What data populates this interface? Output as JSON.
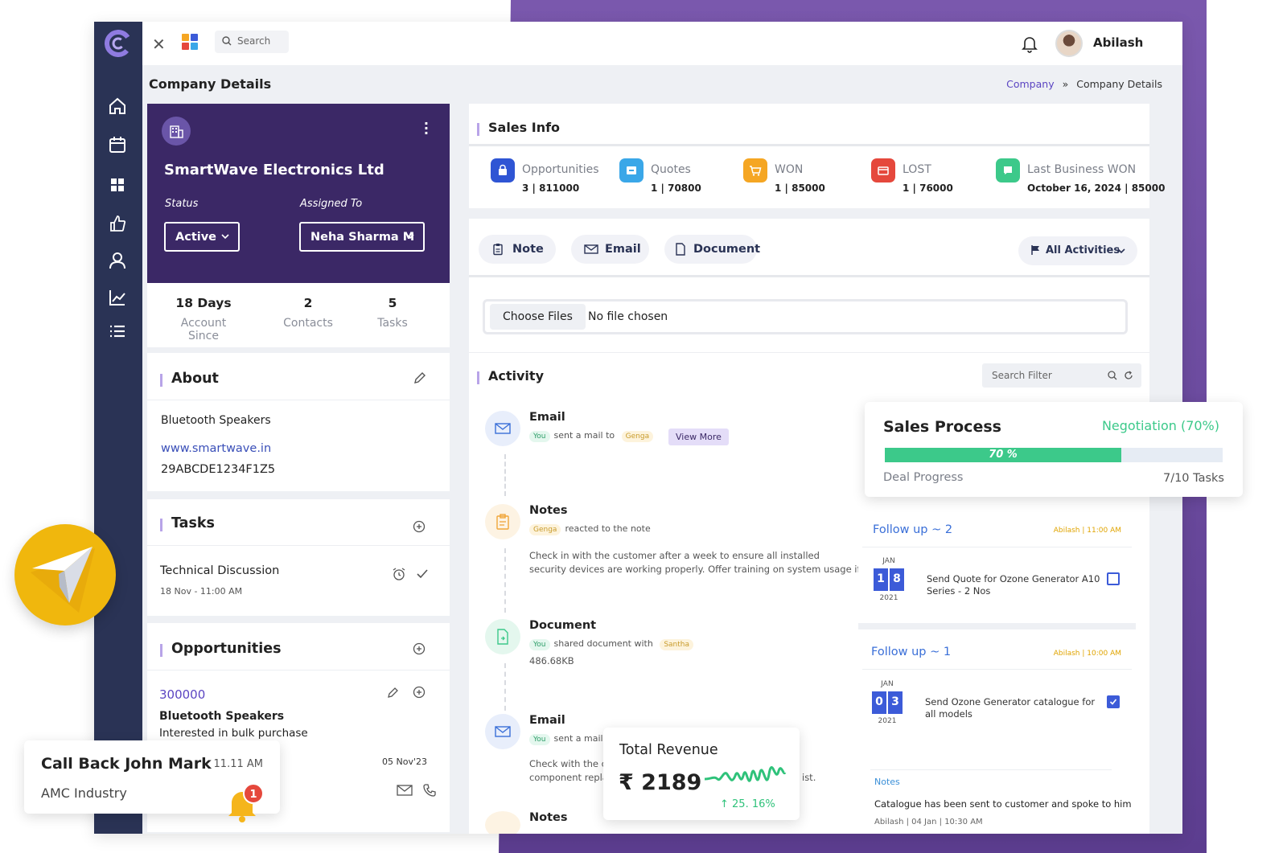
{
  "topbar": {
    "search_placeholder": "Search",
    "user_name": "Abilash"
  },
  "page": {
    "title": "Company Details",
    "breadcrumb": [
      "Company",
      "»",
      "Company Details"
    ]
  },
  "company": {
    "name": "SmartWave Electronics Ltd",
    "status_label": "Status",
    "status_value": "Active",
    "assigned_label": "Assigned To",
    "assigned_value": "Neha Sharma M"
  },
  "stats": [
    {
      "value": "18 Days",
      "label": "Account Since"
    },
    {
      "value": "2",
      "label": "Contacts"
    },
    {
      "value": "5",
      "label": "Tasks"
    }
  ],
  "about": {
    "title": "About",
    "category": "Bluetooth Speakers",
    "website": "www.smartwave.in",
    "gstin": "29ABCDE1234F1Z5"
  },
  "tasks": {
    "title": "Tasks",
    "item_title": "Technical Discussion",
    "item_time": "18 Nov - 11:00 AM"
  },
  "opportunities": {
    "title": "Opportunities",
    "amount": "300000",
    "product": "Bluetooth Speakers",
    "note": "Interested in bulk purchase",
    "date": "05 Nov'23"
  },
  "sales_info": {
    "title": "Sales Info",
    "metrics": [
      {
        "label": "Opportunities",
        "value": "3 | 811000",
        "color": "#2f55d4"
      },
      {
        "label": "Quotes",
        "value": "1 | 70800",
        "color": "#3aa7e8"
      },
      {
        "label": "WON",
        "value": "1 | 85000",
        "color": "#f5a623"
      },
      {
        "label": "LOST",
        "value": "1 | 76000",
        "color": "#e5483c"
      },
      {
        "label": "Last Business WON",
        "value": "October 16, 2024 | 85000",
        "color": "#3cc98a"
      }
    ]
  },
  "activity_tabs": {
    "note": "Note",
    "email": "Email",
    "document": "Document",
    "filter": "All Activities"
  },
  "file_input": {
    "button": "Choose Files",
    "status": "No file chosen"
  },
  "activity": {
    "title": "Activity",
    "search_placeholder": "Search Filter",
    "items": [
      {
        "title": "Email",
        "tag1": "You",
        "text": "sent a mail to",
        "tag2": "Genga",
        "action": "View More"
      },
      {
        "title": "Notes",
        "tag1": "Genga",
        "text": "reacted to the note",
        "desc1": "Check in with the customer after a week to ensure all installed",
        "desc2": "security devices are working properly. Offer training on system usage if needed"
      },
      {
        "title": "Document",
        "tag1": "You",
        "text": "shared document with",
        "tag2": "Santha",
        "size": "486.68KB"
      },
      {
        "title": "Email",
        "tag1": "You",
        "text": "sent a mail t",
        "desc1": "Check with the cu",
        "desc2": "component replac",
        "desc_tail": "ist."
      },
      {
        "title": "Notes"
      }
    ]
  },
  "sales_process": {
    "title": "Sales Process",
    "stage": "Negotiation (70%)",
    "progress": 0.7,
    "progress_label": "70 %",
    "caption": "Deal Progress",
    "tasks": "7/10 Tasks"
  },
  "followups": [
    {
      "title": "Follow up ~ 2",
      "meta": "Abilash | 11:00 AM",
      "month": "JAN",
      "d1": "1",
      "d2": "8",
      "year": "2021",
      "text": "Send Quote for Ozone Generator A10 Series - 2 Nos",
      "checked": false
    },
    {
      "title": "Follow up ~ 1",
      "meta": "Abilash | 10:00 AM",
      "month": "JAN",
      "d1": "0",
      "d2": "3",
      "year": "2021",
      "text": "Send Ozone Generator catalogue for all models",
      "checked": true
    }
  ],
  "notes_panel": {
    "label": "Notes",
    "text": "Catalogue has been sent to customer and spoke to him",
    "meta": "Abilash | 04 Jan | 10:30 AM"
  },
  "callback": {
    "title": "Call Back John Mark",
    "time": "11.11 AM",
    "company": "AMC Industry",
    "badge": "1"
  },
  "revenue": {
    "title": "Total Revenue",
    "amount": "₹ 2189",
    "growth": "↑ 25. 16%"
  }
}
